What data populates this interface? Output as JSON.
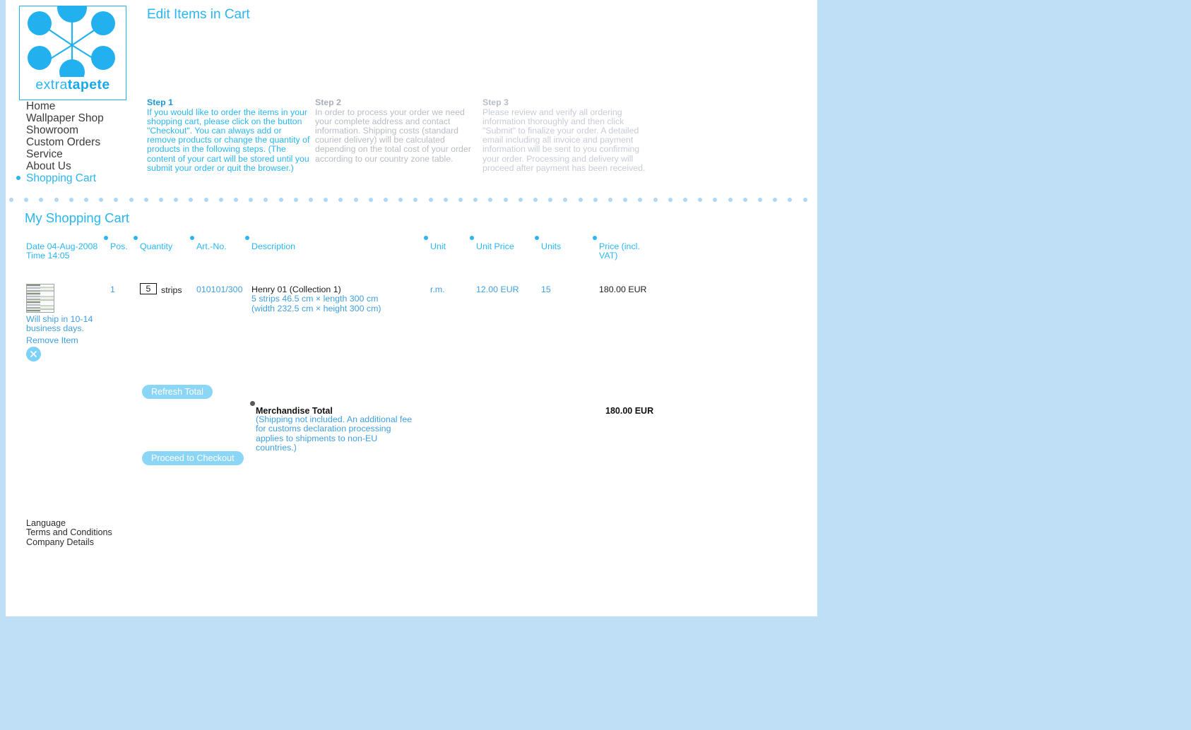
{
  "colors": {
    "page_bg": "#bfdff7",
    "brand_blue": "#29b6f2",
    "link_blue": "#3f9fe0",
    "button_blue": "#8bd6f7",
    "muted_gray": "#b8bcc4",
    "muted_gray_light": "#c7cbd6",
    "dot_divider": "#aed8f5"
  },
  "logo": {
    "word_prefix": "extra",
    "word_suffix": "tapete",
    "icon": "hub-and-spokes-icon"
  },
  "nav": {
    "items": [
      {
        "label": "Home",
        "active": false
      },
      {
        "label": "Wallpaper Shop",
        "active": false
      },
      {
        "label": "Showroom",
        "active": false
      },
      {
        "label": "Custom Orders",
        "active": false
      },
      {
        "label": "Service",
        "active": false
      },
      {
        "label": "About Us",
        "active": false
      },
      {
        "label": "Shopping Cart",
        "active": true
      }
    ]
  },
  "header": {
    "page_title": "Edit Items in Cart"
  },
  "steps": [
    {
      "title": "Step 1",
      "body": "If you would like to order the items in your shopping cart, please click on the button \"Checkout\". You can always add or remove products or change the quantity of products in the following steps. (The content of your cart will be stored until you submit your order or quit the browser.)"
    },
    {
      "title": "Step 2",
      "body": "In order to process your order we need your complete address and contact information. Shipping costs (standard courier delivery) will be calculated depending on the total cost of your order according to our country zone table."
    },
    {
      "title": "Step 3",
      "body": "Please review and verify all ordering information thoroughly and then click \"Submit\" to finalize your order. A detailed email including all invoice and payment information will be sent to you confirming your order. Processing and delivery will proceed after payment has been received."
    }
  ],
  "cart": {
    "title": "My Shopping Cart",
    "date_label": "Date 04-Aug-2008",
    "time_label": "Time 14:05",
    "columns": {
      "pos": "Pos.",
      "quantity": "Quantity",
      "art_no": "Art.-No.",
      "description": "Description",
      "unit": "Unit",
      "unit_price": "Unit Price",
      "units": "Units",
      "price_incl_vat": "Price (incl. VAT)"
    },
    "rows": [
      {
        "pos": "1",
        "quantity_value": "5",
        "quantity_unit": "strips",
        "art_no": "010101/300",
        "description_title": "Henry 01 (Collection 1)",
        "description_line_1": "5 strips 46.5 cm × length 300 cm",
        "description_line_2": "(width 232.5 cm × height 300 cm)",
        "unit": "r.m.",
        "unit_price": "12.00 EUR",
        "units": "15",
        "price": "180.00 EUR",
        "shipping_note": "Will ship in 10-14 business days.",
        "remove_label": "Remove Item",
        "remove_icon": "close-circle-icon",
        "thumbnail": "striped-wallpaper-thumbnail"
      }
    ],
    "refresh_button": "Refresh Total",
    "checkout_button": "Proceed to Checkout",
    "total_label": "Merchandise Total",
    "total_note": "(Shipping not included. An additional fee for customs declaration processing applies to shipments to non-EU countries.)",
    "total_value": "180.00 EUR"
  },
  "footer": {
    "links": [
      {
        "label": "Language"
      },
      {
        "label": "Terms and Conditions"
      },
      {
        "label": "Company Details"
      }
    ]
  }
}
